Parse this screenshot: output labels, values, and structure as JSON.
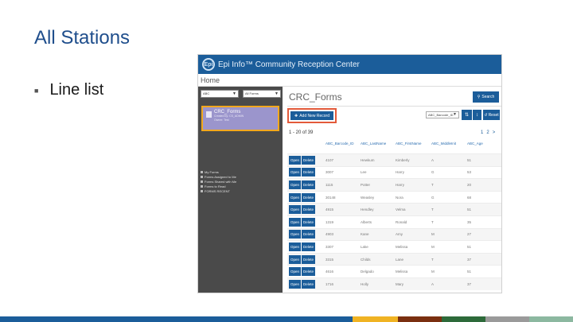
{
  "slide": {
    "title": "All Stations",
    "bullet": "Line list"
  },
  "app": {
    "title": "Epi Info™ Community Reception Center",
    "logo_text": "Epi",
    "breadcrumb": "Home"
  },
  "sidebar": {
    "org_select": "ABC",
    "forms_select": "All Forms",
    "form_card": {
      "name": "CRC_Forms",
      "created_by": "Created by: CS_ADMIN",
      "owner": "Owner: Test"
    },
    "nav_items": [
      "My Forms",
      "Forms Assigned to Me",
      "Forms Shared with Me",
      "Forms to Read",
      "FORMS RECENT"
    ]
  },
  "main": {
    "title": "CRC_Forms",
    "search_label": "Search",
    "add_label": "Add New Record",
    "filter_value": "ABC_Barcode_ID",
    "reset_label": "Reset",
    "record_count": "1 - 20 of 39",
    "pager": [
      "1",
      "2",
      ">"
    ],
    "open_label": "Open",
    "delete_label": "Delete",
    "columns": [
      "ABC_Barcode_ID",
      "ABC_LastName",
      "ABC_FirstName",
      "ABC_MiddleInit",
      "ABC_Age"
    ],
    "rows": [
      [
        "4107",
        "Hewkum",
        "Kimberly",
        "A",
        "51"
      ],
      [
        "3007",
        "Lee",
        "Harry",
        "G",
        "53"
      ],
      [
        "1115",
        "Potter",
        "Harry",
        "T",
        "20"
      ],
      [
        "30148",
        "Weasley",
        "Nora",
        "G",
        "68"
      ],
      [
        "4915",
        "Hendley",
        "Velma",
        "T",
        "51"
      ],
      [
        "1319",
        "Alberts",
        "Ronald",
        "T",
        "35"
      ],
      [
        "4903",
        "Kane",
        "Amy",
        "M",
        "27"
      ],
      [
        "3307",
        "Lake",
        "Melissa",
        "M",
        "51"
      ],
      [
        "3315",
        "Childs",
        "Lane",
        "T",
        "37"
      ],
      [
        "4616",
        "Delgado",
        "Melissa",
        "M",
        "51"
      ],
      [
        "1716",
        "Holly",
        "Mary",
        "A",
        "37"
      ]
    ]
  },
  "colors": {
    "title": "#1f4e8c",
    "header": "#1b5d9a",
    "highlight": "#e35a3a",
    "card_border": "#f2a81d",
    "bottom_bar": [
      "#1b5d9a",
      "#f0b323",
      "#7a2f10",
      "#2d6a3a",
      "#9a9a9a",
      "#8cb8a0"
    ]
  }
}
